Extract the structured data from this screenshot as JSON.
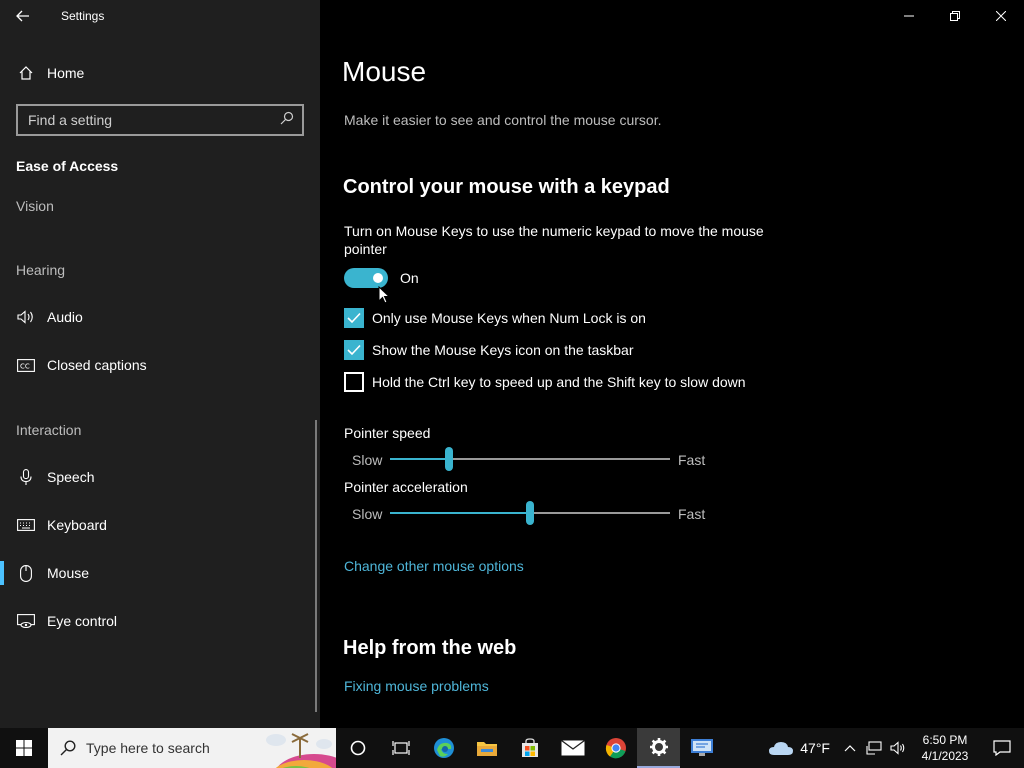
{
  "window": {
    "title": "Settings"
  },
  "sidebar": {
    "home_label": "Home",
    "search_placeholder": "Find a setting",
    "category": "Ease of Access",
    "sections": {
      "vision": "Vision",
      "hearing": "Hearing",
      "interaction": "Interaction"
    },
    "items": [
      {
        "label": "Audio",
        "icon": "speaker-icon"
      },
      {
        "label": "Closed captions",
        "icon": "cc-icon"
      },
      {
        "label": "Speech",
        "icon": "microphone-icon"
      },
      {
        "label": "Keyboard",
        "icon": "keyboard-icon"
      },
      {
        "label": "Mouse",
        "icon": "mouse-icon",
        "selected": true
      },
      {
        "label": "Eye control",
        "icon": "eye-control-icon"
      }
    ]
  },
  "main": {
    "title": "Mouse",
    "description": "Make it easier to see and control the mouse cursor.",
    "keypad_section": {
      "title": "Control your mouse with a keypad",
      "toggle_description": "Turn on Mouse Keys to use the numeric keypad to move the mouse pointer",
      "toggle_state": "On",
      "checkboxes": [
        {
          "label": "Only use Mouse Keys when Num Lock is on",
          "checked": true
        },
        {
          "label": "Show the Mouse Keys icon on the taskbar",
          "checked": true
        },
        {
          "label": "Hold the Ctrl key to speed up and the Shift key to slow down",
          "checked": false
        }
      ]
    },
    "sliders": [
      {
        "label": "Pointer speed",
        "min_label": "Slow",
        "max_label": "Fast",
        "value": 0.21
      },
      {
        "label": "Pointer acceleration",
        "min_label": "Slow",
        "max_label": "Fast",
        "value": 0.5
      }
    ],
    "other_options_link": "Change other mouse options",
    "help_section": {
      "title": "Help from the web",
      "link": "Fixing mouse problems"
    }
  },
  "taskbar": {
    "search_placeholder": "Type here to search",
    "weather": "47°F",
    "time": "6:50 PM",
    "date": "4/1/2023"
  },
  "colors": {
    "accent": "#3ab4cf",
    "link": "#4fb6d9",
    "sidebar_bg": "#1f1f1f",
    "content_bg": "#000000"
  }
}
